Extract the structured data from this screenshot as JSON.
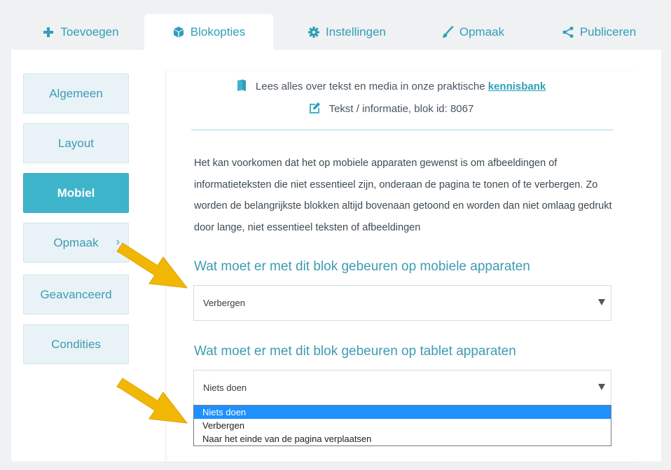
{
  "tabs": [
    {
      "label": "Toevoegen",
      "icon": "plus-icon",
      "active": false
    },
    {
      "label": "Blokopties",
      "icon": "cube-icon",
      "active": true
    },
    {
      "label": "Instellingen",
      "icon": "gear-icon",
      "active": false
    },
    {
      "label": "Opmaak",
      "icon": "brush-icon",
      "active": false
    },
    {
      "label": "Publiceren",
      "icon": "share-icon",
      "active": false
    }
  ],
  "sidebar": {
    "items": [
      {
        "label": "Algemeen"
      },
      {
        "label": "Layout"
      },
      {
        "label": "Mobiel",
        "active": true
      },
      {
        "label": "Opmaak",
        "chevron": "›"
      },
      {
        "label": "Geavanceerd"
      },
      {
        "label": "Condities"
      }
    ]
  },
  "info": {
    "prefix": "Lees alles over tekst en media in onze praktische",
    "link": "kennisbank",
    "block_info": "Tekst / informatie, blok id: 8067"
  },
  "description": "Het kan voorkomen dat het op mobiele apparaten gewenst is om afbeeldingen of informatieteksten die niet essentieel zijn, onderaan de pagina te tonen of te verbergen. Zo worden de belangrijkste blokken altijd bovenaan getoond en worden dan niet omlaag gedrukt door lange, niet essentieel teksten of afbeeldingen",
  "mobile": {
    "question": "Wat moet er met dit blok gebeuren op mobiele apparaten",
    "value": "Verbergen"
  },
  "tablet": {
    "question": "Wat moet er met dit blok gebeuren op tablet apparaten",
    "value": "Niets doen",
    "options": [
      "Niets doen",
      "Verbergen",
      "Naar het einde van de pagina verplaatsen"
    ]
  },
  "colors": {
    "accent": "#3eb4cb",
    "link": "#2f9fb7",
    "arrow": "#f2b705",
    "selected_option": "#1e90ff"
  }
}
